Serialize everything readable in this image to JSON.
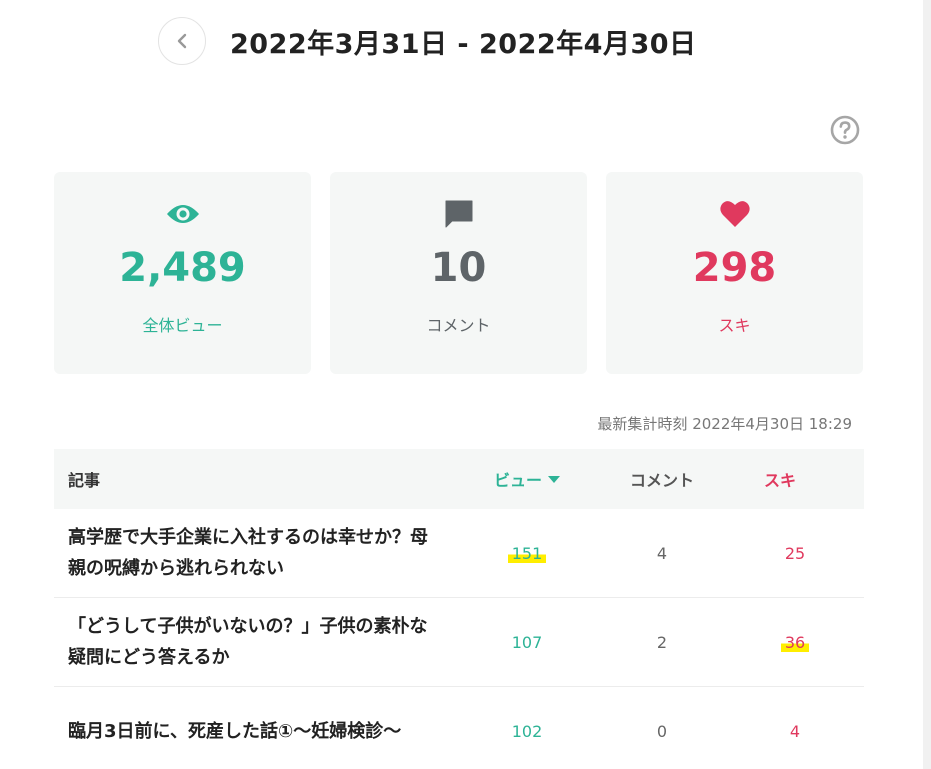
{
  "header": {
    "date_range": "2022年3月31日 - 2022年4月30日"
  },
  "summary": {
    "views": {
      "value": "2,489",
      "label": "全体ビュー"
    },
    "comments": {
      "value": "10",
      "label": "コメント"
    },
    "likes": {
      "value": "298",
      "label": "スキ"
    }
  },
  "updated_at": "最新集計時刻 2022年4月30日 18:29",
  "table": {
    "headers": {
      "title": "記事",
      "views": "ビュー",
      "comments": "コメント",
      "likes": "スキ"
    },
    "rows": [
      {
        "title": "高学歴で大手企業に入社するのは幸せか？母親の呪縛から逃れられない",
        "views": "151",
        "comments": "4",
        "likes": "25"
      },
      {
        "title": "「どうして子供がいないの？」子供の素朴な疑問にどう答えるか",
        "views": "107",
        "comments": "2",
        "likes": "36"
      },
      {
        "title": "臨月3日前に、死産した話①～妊婦検診～",
        "views": "102",
        "comments": "0",
        "likes": "4"
      }
    ]
  },
  "colors": {
    "views": "#2db396",
    "comments": "#5e6468",
    "likes": "#e0395e",
    "highlight": "#ffee00"
  },
  "icons": [
    "chevron-left-icon",
    "help-icon",
    "eye-icon",
    "comment-icon",
    "heart-icon",
    "sort-down-icon"
  ]
}
